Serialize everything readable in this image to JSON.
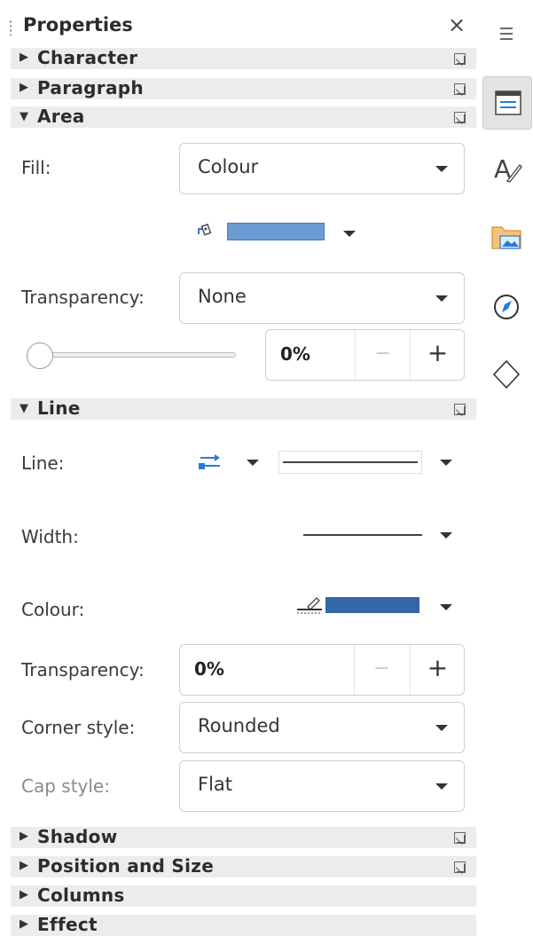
{
  "panel": {
    "title": "Properties",
    "close_glyph": "×"
  },
  "sections": {
    "character": "Character",
    "paragraph": "Paragraph",
    "area": "Area",
    "line": "Line",
    "shadow": "Shadow",
    "position": "Position and Size",
    "columns": "Columns",
    "effect": "Effect"
  },
  "area": {
    "fill_label": "Fill:",
    "fill_value": "Colour",
    "fill_color": "#6b9bd2",
    "transparency_label": "Transparency:",
    "transparency_value": "None",
    "transparency_percent": "0%",
    "slider_value": 0
  },
  "line": {
    "line_label": "Line:",
    "width_label": "Width:",
    "colour_label": "Colour:",
    "line_color": "#3465a4",
    "transparency_label": "Transparency:",
    "transparency_value": "0%",
    "corner_label": "Corner style:",
    "corner_value": "Rounded",
    "cap_label": "Cap style:",
    "cap_value": "Flat"
  },
  "spin": {
    "minus": "−",
    "plus": "+"
  },
  "tabbar": {
    "icons": [
      "menu-icon",
      "properties-icon",
      "styles-icon",
      "gallery-icon",
      "navigator-icon",
      "shapes-icon"
    ]
  },
  "colors": {
    "accent": "#2a7bd4",
    "section_bg": "#ececec"
  }
}
